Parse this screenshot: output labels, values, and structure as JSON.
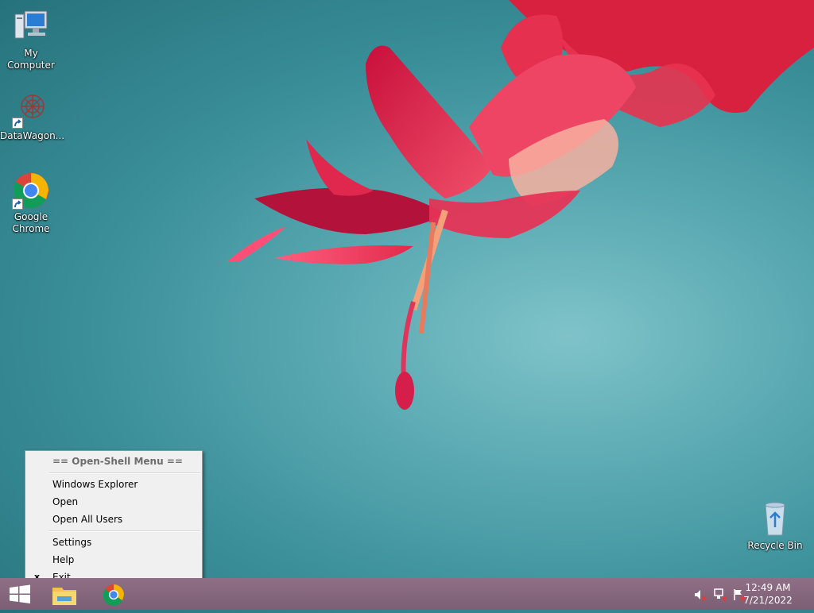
{
  "desktop": {
    "icons": [
      {
        "label": "My Computer",
        "icon": "computer-icon"
      },
      {
        "label": "DataWagon...",
        "icon": "datawagon-icon"
      },
      {
        "label_line1": "Google",
        "label_line2": "Chrome",
        "icon": "chrome-icon"
      },
      {
        "label": "Recycle Bin",
        "icon": "recycle-bin-icon"
      }
    ]
  },
  "context_menu": {
    "header": "== Open-Shell Menu ==",
    "items": [
      {
        "label": "Windows Explorer"
      },
      {
        "label": "Open"
      },
      {
        "label": "Open All Users"
      },
      {
        "label": "Settings"
      },
      {
        "label": "Help"
      },
      {
        "label": "Exit",
        "mark": "x"
      }
    ]
  },
  "taskbar": {
    "start_icon": "windows-logo-icon",
    "pinned": [
      "file-explorer-icon",
      "chrome-icon"
    ],
    "tray": [
      "volume-muted-icon",
      "network-icon",
      "action-center-flag-icon"
    ],
    "clock": {
      "time": "12:49 AM",
      "date": "7/21/2022"
    }
  },
  "colors": {
    "taskbar": "#7c5f74",
    "menu_bg": "#f0f0f0",
    "flower": "#e0345a"
  }
}
